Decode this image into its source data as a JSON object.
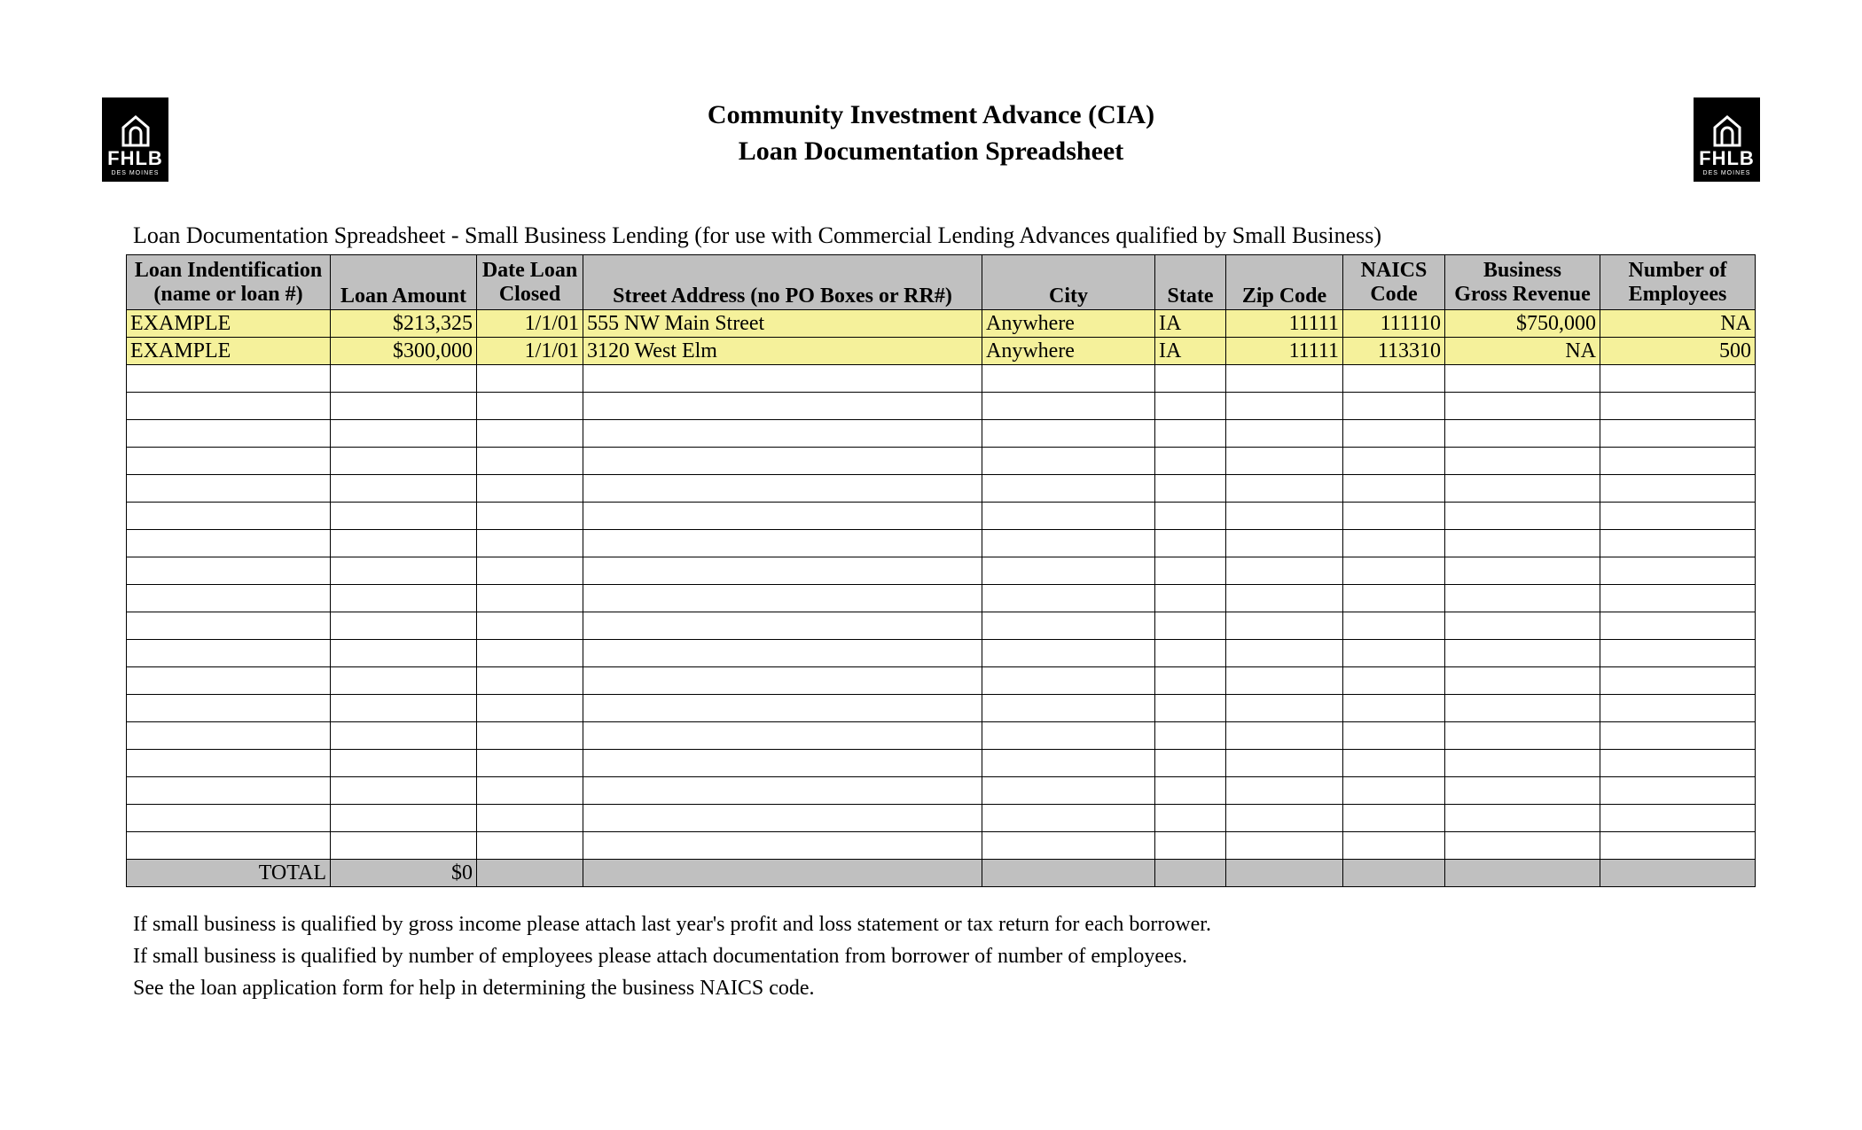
{
  "logo": {
    "fhlb": "FHLB",
    "sub": "DES MOINES"
  },
  "title_line1": "Community Investment Advance (CIA)",
  "title_line2": "Loan Documentation Spreadsheet",
  "subtitle": "Loan Documentation Spreadsheet - Small Business Lending (for use with Commercial Lending Advances qualified by Small Business)",
  "headers": {
    "loan_id_l1": "Loan Indentification",
    "loan_id_l2": "(name or loan #)",
    "loan_amount": "Loan Amount",
    "date_l1": "Date Loan",
    "date_l2": "Closed",
    "address": "Street Address (no PO Boxes or RR#)",
    "city": "City",
    "state": "State",
    "zip": "Zip Code",
    "naics_l1": "NAICS",
    "naics_l2": "Code",
    "rev_l1": "Business",
    "rev_l2": "Gross Revenue",
    "emp_l1": "Number of",
    "emp_l2": "Employees"
  },
  "rows": [
    {
      "id": "EXAMPLE",
      "amount": "$213,325",
      "date": "1/1/01",
      "address": "555 NW Main Street",
      "city": "Anywhere",
      "state": "IA",
      "zip": "11111",
      "naics": "111110",
      "revenue": "$750,000",
      "employees": "NA"
    },
    {
      "id": "EXAMPLE",
      "amount": "$300,000",
      "date": "1/1/01",
      "address": "3120 West Elm",
      "city": "Anywhere",
      "state": "IA",
      "zip": "11111",
      "naics": "113310",
      "revenue": "NA",
      "employees": "500"
    }
  ],
  "empty_row_count": 18,
  "total": {
    "label": "TOTAL",
    "amount": "$0"
  },
  "notes": [
    "If small business is qualified by gross income please attach last year's profit and loss statement or tax return for each borrower.",
    "If small business is qualified by number of employees please attach documentation from borrower of number of employees.",
    "See the loan application form for help in determining the business NAICS code."
  ]
}
